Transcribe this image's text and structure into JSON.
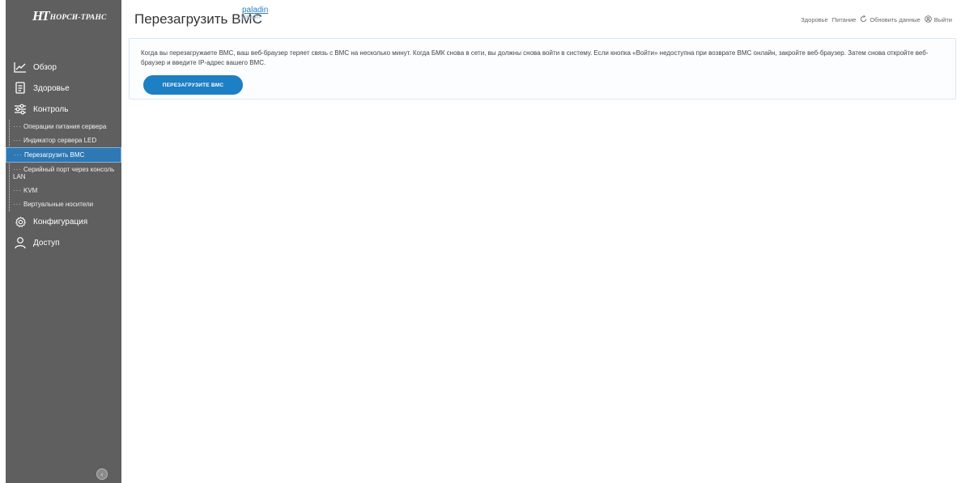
{
  "brand": {
    "mark": "НТ",
    "name": "НОРСИ-ТРАНС"
  },
  "sidebar": {
    "items": [
      {
        "label": "Обзор",
        "icon": "chart-line-icon"
      },
      {
        "label": "Здоровье",
        "icon": "document-list-icon"
      },
      {
        "label": "Контроль",
        "icon": "sliders-icon"
      },
      {
        "label": "Конфигурация",
        "icon": "gear-icon"
      },
      {
        "label": "Доступ",
        "icon": "user-icon"
      }
    ],
    "control_subitems": [
      "Операции питания сервера",
      "Индикатор сервера LED",
      "Перезагрузить BMC",
      "Серийный порт через консоль LAN",
      "KVM",
      "Виртуальные носители"
    ],
    "active_subitem": "Перезагрузить BMC",
    "collapse_icon": "chevron-left-icon"
  },
  "header": {
    "title": "Перезагрузить BMC",
    "user": "paladin",
    "user_sub": "paladin",
    "links": {
      "health": "Здоровье",
      "power": "Питание",
      "refresh": "Обновить данные",
      "logout": "Выйти"
    }
  },
  "content": {
    "notice": "Когда вы перезагружаете BMC, ваш веб-браузер теряет связь с BMC на несколько минут. Когда БМК снова в сети, вы должны снова войти в систему. Если кнопка «Войти» недоступна при возврате BMC онлайн, закройте веб-браузер. Затем снова откройте веб-браузер и введите IP-адрес вашего BMC.",
    "button": "ПЕРЕЗАГРУЗИТЕ BMC"
  },
  "colors": {
    "sidebar": "#5f5f5f",
    "accent": "#1d7fc4",
    "active": "#2e78b4"
  }
}
